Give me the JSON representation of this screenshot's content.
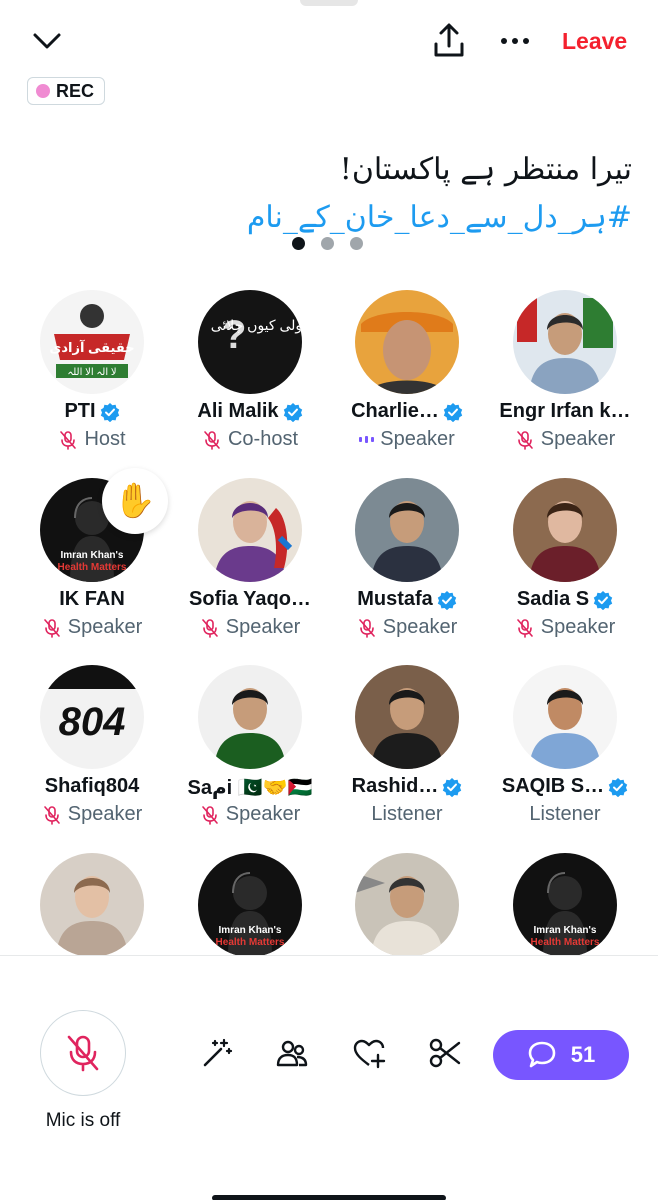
{
  "header": {
    "leave_label": "Leave",
    "rec_label": "REC",
    "icons": [
      "chevron-down-icon",
      "share-icon",
      "more-icon"
    ]
  },
  "space": {
    "title_text": "تیرا منتظر ہے پاکستان!",
    "title_hashtag": "#ہر_دل_سے_دعا_خان_کے_نام",
    "pages": 3,
    "current_page": 1
  },
  "participants": [
    {
      "name": "PTI",
      "role": "Host",
      "verified": true,
      "mic": "off"
    },
    {
      "name": "Ali Malik",
      "role": "Co-host",
      "verified": true,
      "mic": "off"
    },
    {
      "name": "Charlie…",
      "role": "Speaker",
      "verified": true,
      "mic": "speaking"
    },
    {
      "name": "Engr Irfan k…",
      "role": "Speaker",
      "verified": false,
      "mic": "off"
    },
    {
      "name": "IK FAN",
      "role": "Speaker",
      "verified": false,
      "mic": "off",
      "hand_raised": true
    },
    {
      "name": "Sofia Yaqo…",
      "role": "Speaker",
      "verified": false,
      "mic": "off"
    },
    {
      "name": "Mustafa",
      "role": "Speaker",
      "verified": true,
      "mic": "off"
    },
    {
      "name": "Sadia S",
      "role": "Speaker",
      "verified": true,
      "mic": "off"
    },
    {
      "name": "Shafiq804",
      "role": "Speaker",
      "verified": false,
      "mic": "off"
    },
    {
      "name": "Saمi 🇵🇰🤝🇵🇸",
      "role": "Speaker",
      "verified": false,
      "mic": "off"
    },
    {
      "name": "Rashid…",
      "role": "Listener",
      "verified": true,
      "mic": "none"
    },
    {
      "name": "SAQIB S…",
      "role": "Listener",
      "verified": true,
      "mic": "none"
    },
    {
      "name": "",
      "role": "",
      "verified": false,
      "mic": "none"
    },
    {
      "name": "",
      "role": "",
      "verified": false,
      "mic": "none"
    },
    {
      "name": "",
      "role": "",
      "verified": false,
      "mic": "none"
    },
    {
      "name": "",
      "role": "",
      "verified": false,
      "mic": "none"
    }
  ],
  "avatar_texts": {
    "pti_text": "حقیقی آزادی",
    "pti_band": "لا الہ الا اللہ",
    "ali_text": "گولی کیوں چلائی",
    "ikfan_line1": "Imran Khan's",
    "ikfan_line2": "Health Matters",
    "shafiq_number": "804"
  },
  "footer": {
    "mic_label": "Mic is off",
    "chat_count": "51",
    "tool_icons": [
      "magic-wand-icon",
      "people-icon",
      "heart-plus-icon",
      "scissors-icon"
    ]
  },
  "colors": {
    "leave": "#f4212e",
    "hashtag": "#1d9bf0",
    "mic_off": "#e0245e",
    "verified": "#1d9bf0",
    "chat_button": "#7856ff"
  }
}
